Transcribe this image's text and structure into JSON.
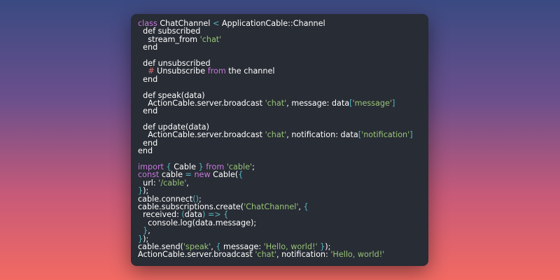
{
  "code": {
    "lines": [
      [
        {
          "t": "class",
          "c": "kw"
        },
        {
          "t": " ChatChannel ",
          "c": "plain"
        },
        {
          "t": "<",
          "c": "op"
        },
        {
          "t": " ApplicationCable::Channel",
          "c": "plain"
        }
      ],
      [
        {
          "t": "  def subscribed",
          "c": "plain"
        }
      ],
      [
        {
          "t": "    stream_from ",
          "c": "plain"
        },
        {
          "t": "'chat'",
          "c": "str"
        }
      ],
      [
        {
          "t": "  end",
          "c": "plain"
        }
      ],
      [],
      [
        {
          "t": "  def unsubscribed",
          "c": "plain"
        }
      ],
      [
        {
          "t": "    # ",
          "c": "cmt"
        },
        {
          "t": "Unsubscribe ",
          "c": "plain"
        },
        {
          "t": "from",
          "c": "kw"
        },
        {
          "t": " the channel",
          "c": "plain"
        }
      ],
      [
        {
          "t": "  end",
          "c": "plain"
        }
      ],
      [],
      [
        {
          "t": "  def speak(data)",
          "c": "plain"
        }
      ],
      [
        {
          "t": "    ActionCable.server.broadcast ",
          "c": "plain"
        },
        {
          "t": "'chat'",
          "c": "str"
        },
        {
          "t": ", message: data",
          "c": "plain"
        },
        {
          "t": "[",
          "c": "br"
        },
        {
          "t": "'message'",
          "c": "str"
        },
        {
          "t": "]",
          "c": "br"
        }
      ],
      [
        {
          "t": "  end",
          "c": "plain"
        }
      ],
      [],
      [
        {
          "t": "  def update(data)",
          "c": "plain"
        }
      ],
      [
        {
          "t": "    ActionCable.server.broadcast ",
          "c": "plain"
        },
        {
          "t": "'chat'",
          "c": "str"
        },
        {
          "t": ", notification: data",
          "c": "plain"
        },
        {
          "t": "[",
          "c": "br"
        },
        {
          "t": "'notification'",
          "c": "str"
        },
        {
          "t": "]",
          "c": "br"
        }
      ],
      [
        {
          "t": "  end",
          "c": "plain"
        }
      ],
      [
        {
          "t": "end",
          "c": "plain"
        }
      ],
      [],
      [
        {
          "t": "import",
          "c": "kw"
        },
        {
          "t": " ",
          "c": "plain"
        },
        {
          "t": "{",
          "c": "br"
        },
        {
          "t": " Cable ",
          "c": "plain"
        },
        {
          "t": "}",
          "c": "br"
        },
        {
          "t": " ",
          "c": "plain"
        },
        {
          "t": "from",
          "c": "kw"
        },
        {
          "t": " ",
          "c": "plain"
        },
        {
          "t": "'cable'",
          "c": "str"
        },
        {
          "t": ";",
          "c": "plain"
        }
      ],
      [
        {
          "t": "const",
          "c": "kw"
        },
        {
          "t": " cable ",
          "c": "plain"
        },
        {
          "t": "=",
          "c": "op"
        },
        {
          "t": " ",
          "c": "plain"
        },
        {
          "t": "new",
          "c": "kw"
        },
        {
          "t": " Cable(",
          "c": "plain"
        },
        {
          "t": "{",
          "c": "br"
        }
      ],
      [
        {
          "t": "  url: ",
          "c": "plain"
        },
        {
          "t": "'/cable'",
          "c": "str"
        },
        {
          "t": ",",
          "c": "plain"
        }
      ],
      [
        {
          "t": "}",
          "c": "br"
        },
        {
          "t": ");",
          "c": "plain"
        }
      ],
      [
        {
          "t": "cable.connect",
          "c": "plain"
        },
        {
          "t": "()",
          "c": "br"
        },
        {
          "t": ";",
          "c": "plain"
        }
      ],
      [
        {
          "t": "cable.subscriptions.create(",
          "c": "plain"
        },
        {
          "t": "'ChatChannel'",
          "c": "str"
        },
        {
          "t": ", ",
          "c": "plain"
        },
        {
          "t": "{",
          "c": "br"
        }
      ],
      [
        {
          "t": "  received: ",
          "c": "plain"
        },
        {
          "t": "(",
          "c": "br"
        },
        {
          "t": "data",
          "c": "plain"
        },
        {
          "t": ")",
          "c": "br"
        },
        {
          "t": " ",
          "c": "plain"
        },
        {
          "t": "=>",
          "c": "op"
        },
        {
          "t": " ",
          "c": "plain"
        },
        {
          "t": "{",
          "c": "br"
        }
      ],
      [
        {
          "t": "    console.log(data.message);",
          "c": "plain"
        }
      ],
      [
        {
          "t": "  ",
          "c": "plain"
        },
        {
          "t": "}",
          "c": "br"
        },
        {
          "t": ",",
          "c": "plain"
        }
      ],
      [
        {
          "t": "}",
          "c": "br"
        },
        {
          "t": ");",
          "c": "plain"
        }
      ],
      [
        {
          "t": "cable.send(",
          "c": "plain"
        },
        {
          "t": "'speak'",
          "c": "str"
        },
        {
          "t": ", ",
          "c": "plain"
        },
        {
          "t": "{",
          "c": "br"
        },
        {
          "t": " message: ",
          "c": "plain"
        },
        {
          "t": "'Hello, world!'",
          "c": "str"
        },
        {
          "t": " ",
          "c": "plain"
        },
        {
          "t": "}",
          "c": "br"
        },
        {
          "t": ");",
          "c": "plain"
        }
      ],
      [
        {
          "t": "ActionCable.server.broadcast ",
          "c": "plain"
        },
        {
          "t": "'chat'",
          "c": "str"
        },
        {
          "t": ", notification: ",
          "c": "plain"
        },
        {
          "t": "'Hello, world!'",
          "c": "str"
        }
      ]
    ]
  }
}
